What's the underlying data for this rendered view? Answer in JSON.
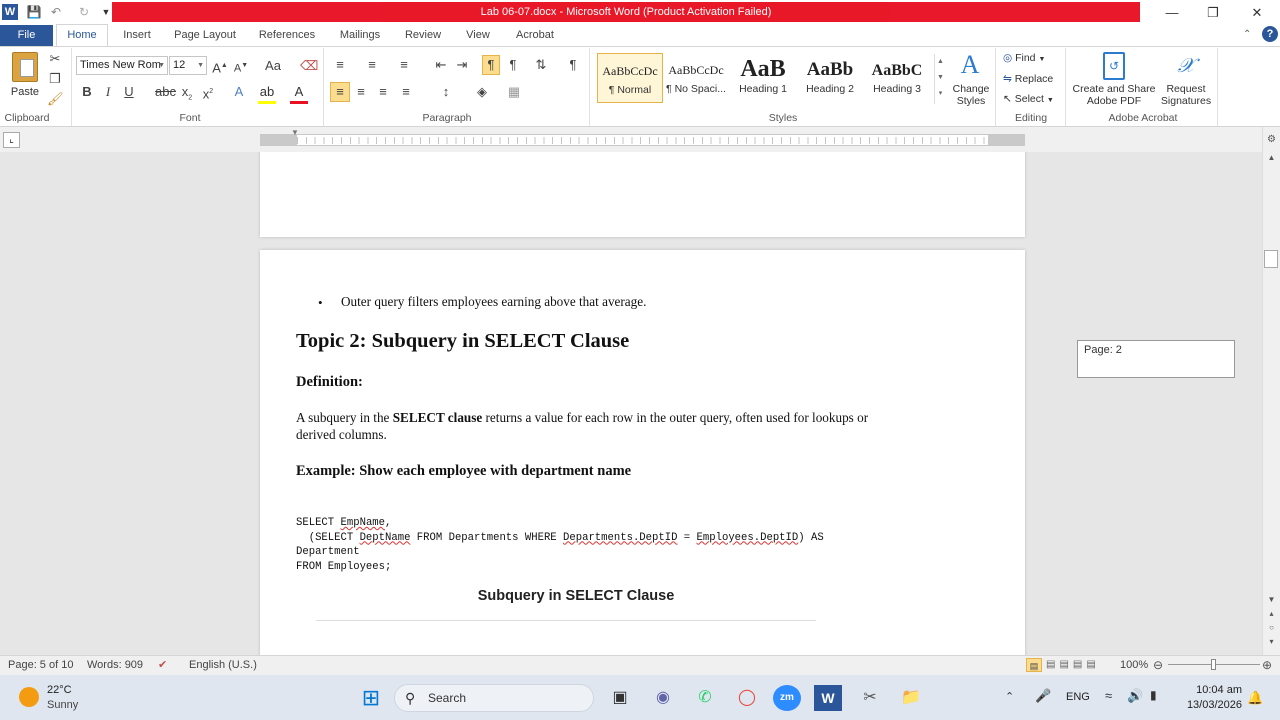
{
  "window": {
    "title": "Lab 06-07.docx  -  Microsoft Word (Product Activation Failed)"
  },
  "tabs": [
    "File",
    "Home",
    "Insert",
    "Page Layout",
    "References",
    "Mailings",
    "Review",
    "View",
    "Acrobat"
  ],
  "ribbon": {
    "clipboard": {
      "paste": "Paste",
      "label": "Clipboard"
    },
    "font": {
      "name": "Times New Rom",
      "size": "12",
      "label": "Font"
    },
    "paragraph": {
      "label": "Paragraph"
    },
    "styles": {
      "items": [
        {
          "preview": "AaBbCcDc",
          "name": "¶ Normal"
        },
        {
          "preview": "AaBbCcDc",
          "name": "¶ No Spaci..."
        },
        {
          "preview": "AaB",
          "name": "Heading 1"
        },
        {
          "preview": "AaBb",
          "name": "Heading 2"
        },
        {
          "preview": "AaBbC",
          "name": "Heading 3"
        }
      ],
      "change_styles": "Change Styles",
      "label": "Styles"
    },
    "editing": {
      "find": "Find",
      "replace": "Replace",
      "select": "Select",
      "label": "Editing"
    },
    "acrobat": {
      "create_share": "Create and Share Adobe PDF",
      "request_sign": "Request Signatures",
      "label": "Adobe Acrobat"
    }
  },
  "document": {
    "bullet": "Outer query filters employees earning above that average.",
    "heading": "Topic 2: Subquery in SELECT Clause",
    "definition_label": "Definition:",
    "para_pre": "A subquery in the ",
    "para_bold": "SELECT clause",
    "para_post": " returns a value for each row in the outer query, often used for lookups or",
    "para_line2": "derived columns.",
    "example": "Example: Show each employee with department name",
    "code": {
      "l1a": "SELECT ",
      "l1b": "EmpName",
      "l1c": ",",
      "l2a": "  (SELECT ",
      "l2b": "DeptName",
      "l2c": " FROM Departments WHERE ",
      "l2d": "Departments.DeptID",
      "l2e": " = ",
      "l2f": "Employees.DeptID",
      "l2g": ") AS",
      "l3": "Department",
      "l4": "FROM Employees;"
    },
    "figure_title": "Subquery in SELECT Clause"
  },
  "page_tooltip": "Page: 2",
  "status": {
    "page": "Page: 5 of 10",
    "words": "Words: 909",
    "language": "English (U.S.)",
    "zoom": "100%"
  },
  "taskbar": {
    "temp": "22°C",
    "weather": "Sunny",
    "search": "Search",
    "lang": "ENG",
    "time": "10:04 am",
    "date": "13/03/2026"
  },
  "colors": {
    "accent": "#2b579a",
    "title_red": "#e81123"
  }
}
